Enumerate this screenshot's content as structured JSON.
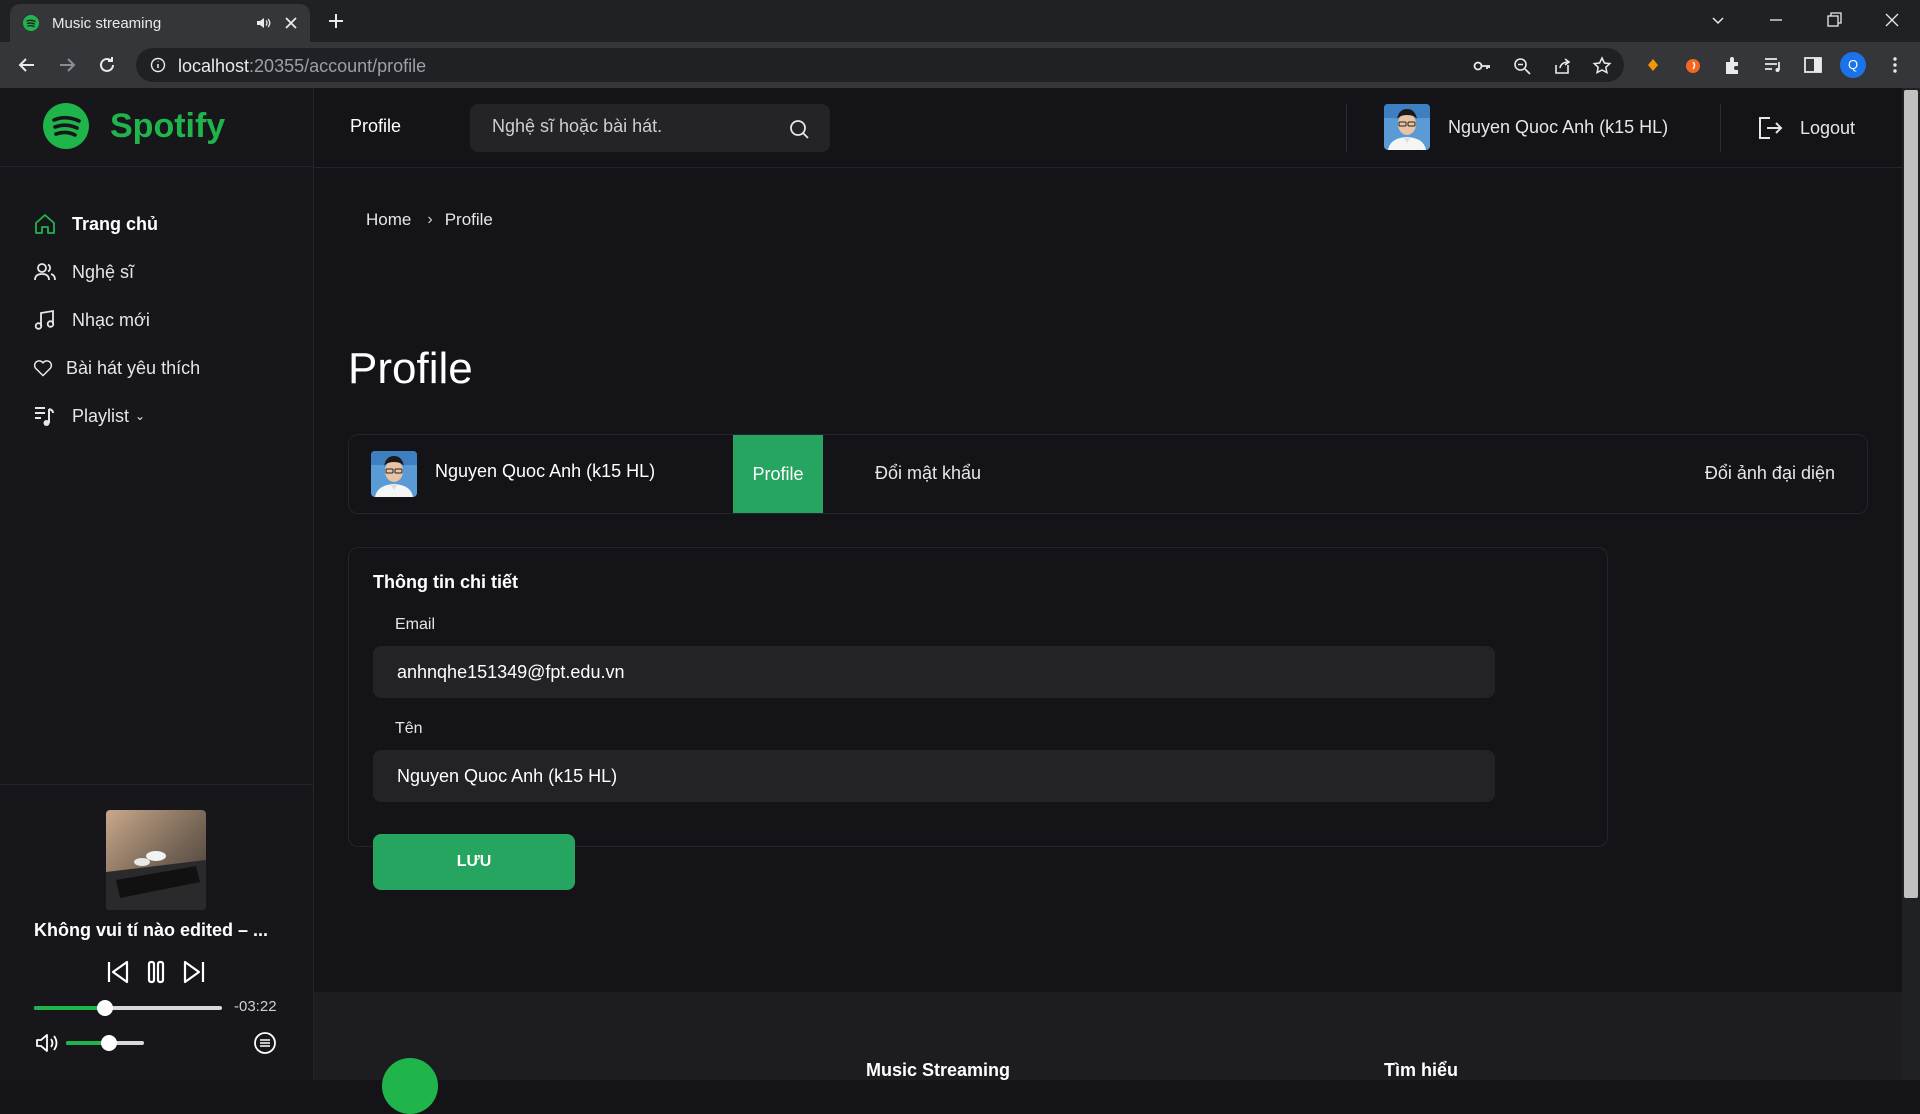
{
  "browser": {
    "tab_title": "Music streaming",
    "url_host": "localhost",
    "url_rest": ":20355/account/profile",
    "profile_initial": "Q"
  },
  "app": {
    "brand": "Spotify",
    "header": {
      "title": "Profile",
      "search_placeholder": "Nghệ sĩ hoặc bài hát.",
      "user_name": "Nguyen Quoc Anh (k15 HL)",
      "logout_label": "Logout"
    },
    "sidebar": {
      "items": [
        {
          "label": "Trang chủ",
          "icon": "home-icon"
        },
        {
          "label": "Nghệ sĩ",
          "icon": "users-icon"
        },
        {
          "label": "Nhạc mới",
          "icon": "music-note-icon"
        },
        {
          "label": "Bài hát yêu thích",
          "icon": "heart-icon"
        },
        {
          "label": "Playlist",
          "icon": "playlist-icon"
        }
      ]
    },
    "player": {
      "song_title": "Không vui tí nào edited – ...",
      "time_remaining": "-03:22",
      "progress": 0.38,
      "volume": 0.55
    },
    "breadcrumb": {
      "home": "Home",
      "separator": "›",
      "current": "Profile"
    },
    "page_title": "Profile",
    "profile_tabs": {
      "user_name": "Nguyen Quoc Anh (k15 HL)",
      "tab_profile": "Profile",
      "tab_password": "Đổi mật khẩu",
      "tab_avatar": "Đổi ảnh đại diện"
    },
    "form": {
      "title": "Thông tin chi tiết",
      "email_label": "Email",
      "email_value": "anhnqhe151349@fpt.edu.vn",
      "name_label": "Tên",
      "name_value": "Nguyen Quoc Anh (k15 HL)",
      "save_label": "LƯU"
    },
    "footer": {
      "col1": "Music Streaming",
      "col2": "Tìm hiểu"
    }
  },
  "colors": {
    "accent_green": "#25a560",
    "brand_green": "#1fb54a",
    "background": "#141418"
  }
}
